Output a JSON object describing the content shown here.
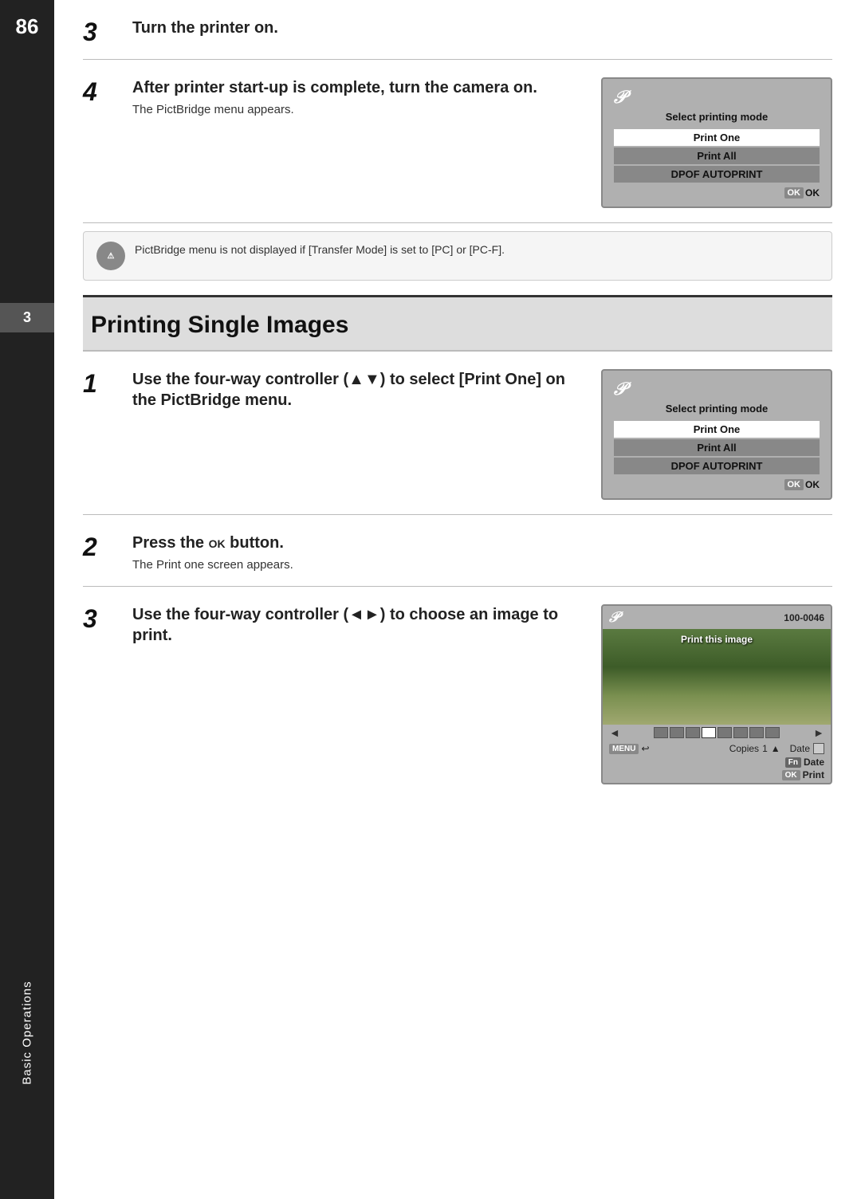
{
  "sidebar": {
    "page_number": "86",
    "badge_number": "3",
    "label": "Basic Operations"
  },
  "steps_top": [
    {
      "number": "3",
      "title": "Turn the printer on.",
      "desc": "",
      "has_screen": false
    },
    {
      "number": "4",
      "title": "After printer start-up is complete, turn the camera on.",
      "desc": "The PictBridge menu appears.",
      "has_screen": true,
      "screen": {
        "logo": "𝒫",
        "title": "Select printing mode",
        "items": [
          "Print One",
          "Print All",
          "DPOF AUTOPRINT"
        ],
        "selected": 0,
        "ok_label": "OK"
      }
    }
  ],
  "caution": {
    "text": "PictBridge menu is not displayed if [Transfer Mode] is set to [PC] or [PC-F].",
    "icon_label": "Caution"
  },
  "section": {
    "title": "Printing Single Images"
  },
  "steps_bottom": [
    {
      "number": "1",
      "title": "Use the four-way controller (▲▼) to select [Print One] on the PictBridge menu.",
      "desc": "",
      "has_screen": true,
      "screen": {
        "logo": "𝒫",
        "title": "Select printing mode",
        "items": [
          "Print One",
          "Print All",
          "DPOF AUTOPRINT"
        ],
        "selected": 0,
        "ok_label": "OK"
      }
    },
    {
      "number": "2",
      "title": "Press the OK button.",
      "desc": "The Print one screen appears.",
      "has_screen": false
    },
    {
      "number": "3",
      "title": "Use the four-way controller (◄►) to choose an image to print.",
      "desc": "",
      "has_screen": true,
      "image_screen": {
        "logo": "𝒫",
        "file_number": "100-0046",
        "print_text": "Print this image",
        "copies_label": "Copies",
        "copies_value": "1",
        "date_label": "Date",
        "menu_label": "MENU",
        "menu_icon": "↩",
        "fn_label": "Fn",
        "fn_value": "Date",
        "ok_label": "OK",
        "ok_value": "Print"
      }
    }
  ]
}
